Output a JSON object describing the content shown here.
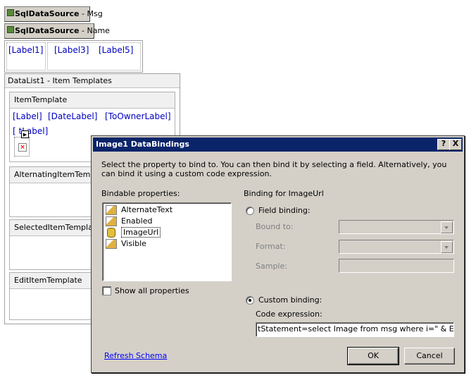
{
  "designer": {
    "sds_msg": {
      "bold": "SqlDataSource",
      "suffix": " - Msg"
    },
    "sds_name": {
      "bold": "SqlDataSource",
      "suffix": " - Name"
    },
    "top_labels": [
      "[Label1]",
      "[Label3]",
      "[Label5]"
    ],
    "datalist_header": "DataList1 - Item Templates",
    "item_template_header": "ItemTemplate",
    "item_labels": [
      "[Label]",
      "[DateLabel]",
      "[ToOwnerLabel]"
    ],
    "item_label_row2": "[ tLabel]",
    "alternating_header": "AlternatingItemTemplat",
    "selected_header": "SelectedItemTemplate",
    "edit_header": "EditItemTemplate"
  },
  "dialog": {
    "title": "Image1 DataBindings",
    "help_button": "?",
    "close_button": "X",
    "description": "Select the property to bind to. You can then bind it by selecting a field. Alternatively, you can bind it using a custom code expression.",
    "bindable_label": "Bindable properties:",
    "properties": [
      {
        "label": "AlternateText",
        "icon": "property-icon",
        "selected": false
      },
      {
        "label": "Enabled",
        "icon": "property-icon",
        "selected": false
      },
      {
        "label": "ImageUrl",
        "icon": "database-cylinder-icon",
        "selected": true
      },
      {
        "label": "Visible",
        "icon": "property-icon",
        "selected": false
      }
    ],
    "show_all_label": "Show all properties",
    "binding_for_label": "Binding for ImageUrl",
    "field_binding_label": "Field binding:",
    "bound_to_label": "Bound to:",
    "format_label": "Format:",
    "sample_label": "Sample:",
    "custom_binding_label": "Custom binding:",
    "code_expression_label": "Code expression:",
    "code_expression_value": "tStatement=select Image from msg where i=\" & Eval(\"I\")",
    "refresh_link": "Refresh Schema",
    "ok_label": "OK",
    "cancel_label": "Cancel",
    "colors": {
      "title_bar": "#0a246a",
      "dialog_face": "#d4d0c8",
      "link": "#0000ff",
      "control_text": "#0000c0"
    }
  }
}
